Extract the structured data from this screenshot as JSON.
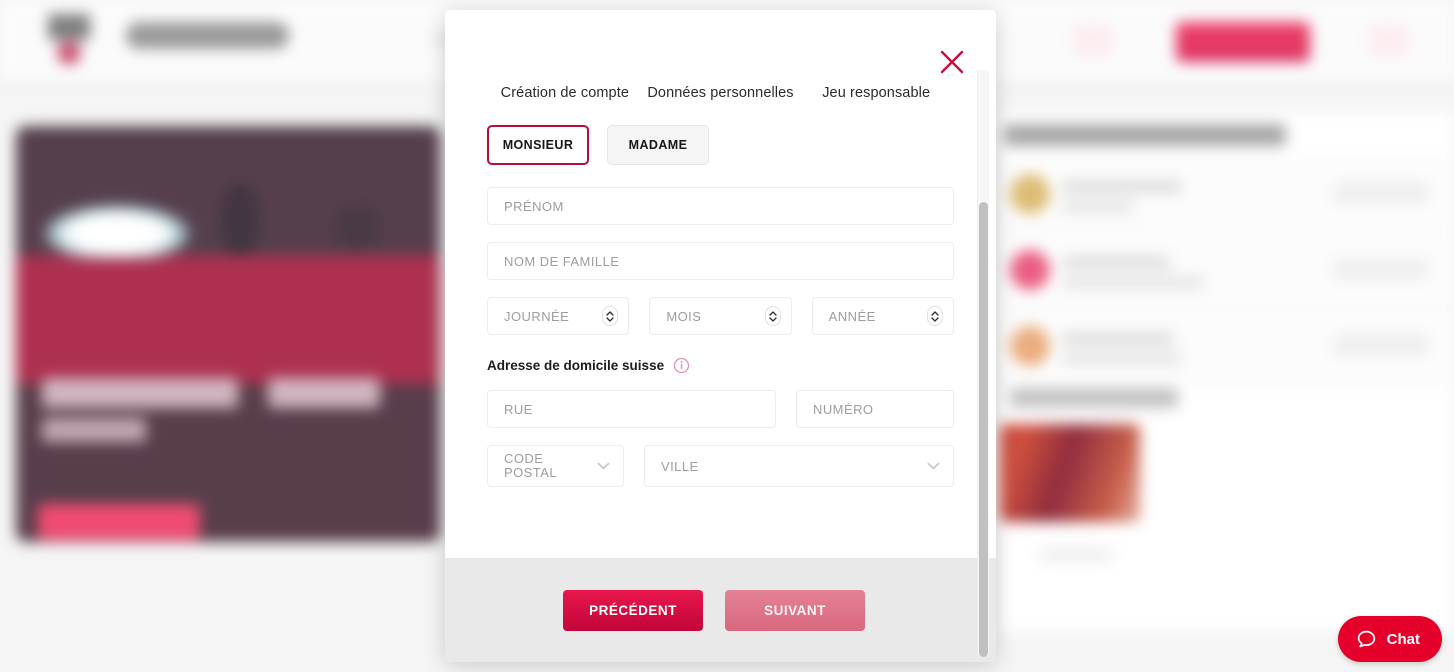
{
  "page": {
    "background_note": "blurred betting site page behind modal",
    "accent_red": "#e4002b",
    "crimson": "#b70d3b"
  },
  "chat_widget": {
    "label": "Chat",
    "icon": "chat-bubble-icon",
    "color": "#e4002b"
  },
  "modal": {
    "close_icon": "close-x-icon",
    "steps": [
      {
        "label": "Création de compte"
      },
      {
        "label": "Données personnelles"
      },
      {
        "label": "Jeu responsable"
      }
    ],
    "gender": {
      "options": [
        {
          "label": "MONSIEUR",
          "selected": true
        },
        {
          "label": "MADAME",
          "selected": false
        }
      ]
    },
    "fields": {
      "firstname": {
        "placeholder": "PRÉNOM",
        "value": ""
      },
      "lastname": {
        "placeholder": "NOM DE FAMILLE",
        "value": ""
      },
      "day": {
        "placeholder": "JOURNÉE",
        "value": "",
        "icon": "stepper-updown-icon"
      },
      "month": {
        "placeholder": "MOIS",
        "value": "",
        "icon": "stepper-updown-icon"
      },
      "year": {
        "placeholder": "ANNÉE",
        "value": "",
        "icon": "stepper-updown-icon"
      },
      "street": {
        "placeholder": "RUE",
        "value": ""
      },
      "number": {
        "placeholder": "NUMÉRO",
        "value": ""
      },
      "postal_code": {
        "placeholder_line1": "CODE",
        "placeholder_line2": "POSTAL",
        "value": "",
        "icon": "chevron-down-icon"
      },
      "city": {
        "placeholder": "VILLE",
        "value": "",
        "icon": "chevron-down-icon"
      }
    },
    "address_section": {
      "title": "Adresse de domicile suisse",
      "info_icon": "info-circle-icon"
    },
    "footer": {
      "previous_label": "PRÉCÉDENT",
      "next_label": "SUIVANT"
    },
    "scrollbar": {
      "name": "modal-scrollbar"
    }
  }
}
